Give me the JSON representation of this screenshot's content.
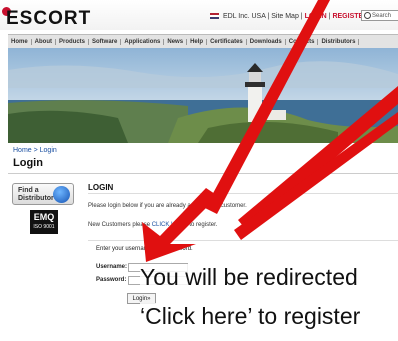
{
  "header": {
    "logo": "ESCORT",
    "top_links": {
      "org": "EDL Inc. USA",
      "sitemap": "Site Map",
      "login": "LOGIN",
      "register": "REGISTER"
    },
    "search_placeholder": "Search"
  },
  "nav": {
    "items": [
      "Home",
      "About",
      "Products",
      "Software",
      "Applications",
      "News",
      "Help",
      "Certificates",
      "Downloads",
      "Contacts",
      "Distributors"
    ]
  },
  "breadcrumb": "Home > Login",
  "page_title": "Login",
  "sidebar": {
    "find_distributor": "Find a Distributor",
    "iso_mark": "EMQ",
    "iso_text": "ISO 9001"
  },
  "content": {
    "section_title": "LOGIN",
    "text_existing": "Please login below if you are already a registered customer.",
    "text_new_before": "New Customers please",
    "link_click_here": "CLICK HERE",
    "text_new_after": "to register.",
    "form_hint": "Enter your username and password.",
    "username_label": "Username:",
    "password_label": "Password:",
    "login_button": "Login»"
  },
  "annotation": {
    "line1": "You will be redirected",
    "line2": "‘Click here’ to register"
  },
  "colors": {
    "arrow": "#e01010",
    "link": "#1a4fa0",
    "brand": "#c8102e"
  }
}
